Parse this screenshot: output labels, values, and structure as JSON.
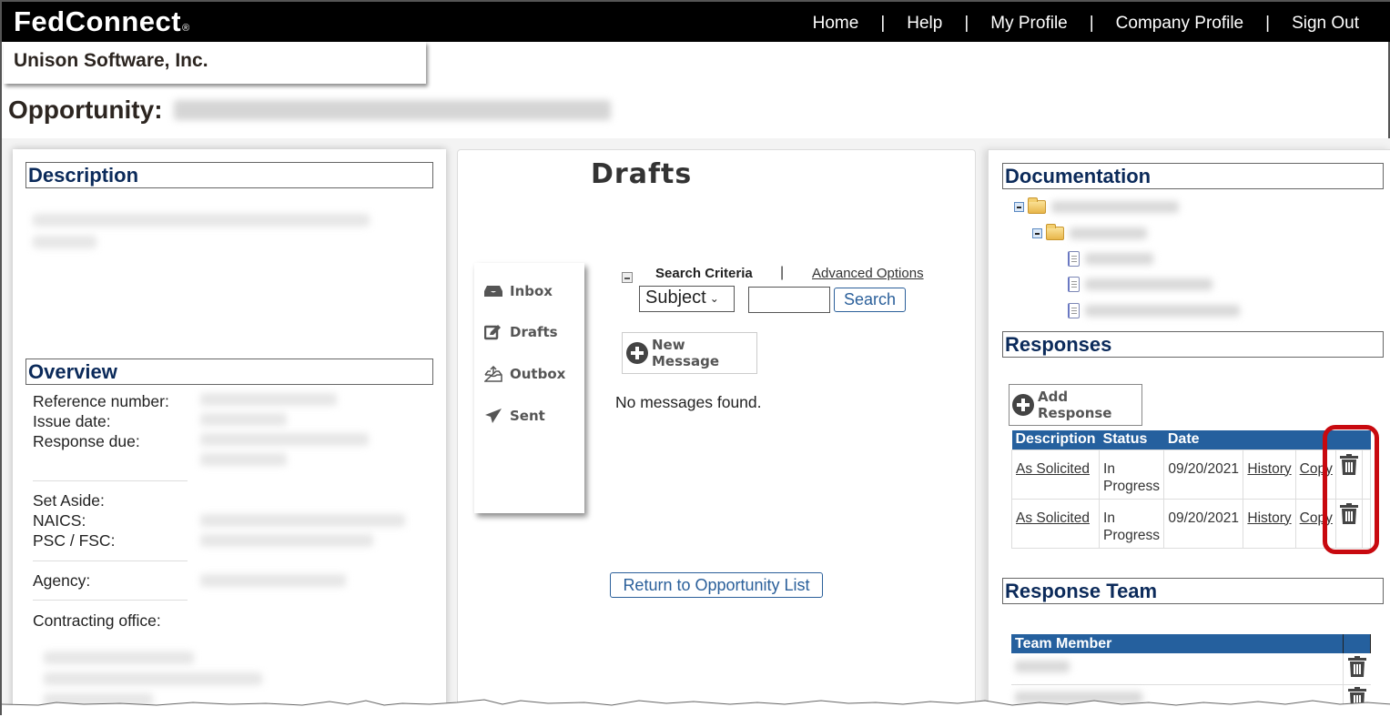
{
  "app": {
    "logo": "FedConnect",
    "logo_mark": "®",
    "nav": [
      "Home",
      "Help",
      "My Profile",
      "Company Profile",
      "Sign Out"
    ],
    "nav_separator": "|",
    "company": "Unison Software, Inc.",
    "opportunity_label": "Opportunity:"
  },
  "left": {
    "description_heading": "Description",
    "overview_heading": "Overview",
    "overview_labels": {
      "reference": "Reference number:",
      "issue": "Issue date:",
      "response_due": "Response due:",
      "set_aside": "Set Aside:",
      "naics": "NAICS:",
      "psc": "PSC / FSC:",
      "agency": "Agency:",
      "office": "Contracting office:"
    }
  },
  "middle": {
    "title": "Drafts",
    "folders": [
      {
        "label": "Inbox",
        "icon": "inbox-icon"
      },
      {
        "label": "Drafts",
        "icon": "edit-icon"
      },
      {
        "label": "Outbox",
        "icon": "outbox-icon"
      },
      {
        "label": "Sent",
        "icon": "send-icon"
      }
    ],
    "search_criteria": "Search Criteria",
    "separator": "|",
    "advanced_options": "Advanced Options",
    "search_field_selected": "Subject",
    "search_input_value": "",
    "search_button": "Search",
    "new_message": "New Message",
    "empty_text": "No messages found.",
    "return_button": "Return to Opportunity List"
  },
  "right": {
    "documentation_heading": "Documentation",
    "responses_heading": "Responses",
    "add_response": "Add Response",
    "responses_table": {
      "headers": [
        "Description",
        "Status",
        "Date"
      ],
      "rows": [
        {
          "description": "As Solicited",
          "status": "In Progress",
          "date": "09/20/2021",
          "history": "History",
          "copy": "Copy"
        },
        {
          "description": "As Solicited",
          "status": "In Progress",
          "date": "09/20/2021",
          "history": "History",
          "copy": "Copy"
        }
      ]
    },
    "team_heading": "Response Team",
    "team_table": {
      "headers": [
        "Team Member"
      ]
    }
  },
  "colors": {
    "header_bg": "#000000",
    "heading_text": "#0b2a5a",
    "table_header": "#25609e",
    "link_button": "#2a5f9a",
    "highlight": "#c8090f"
  }
}
